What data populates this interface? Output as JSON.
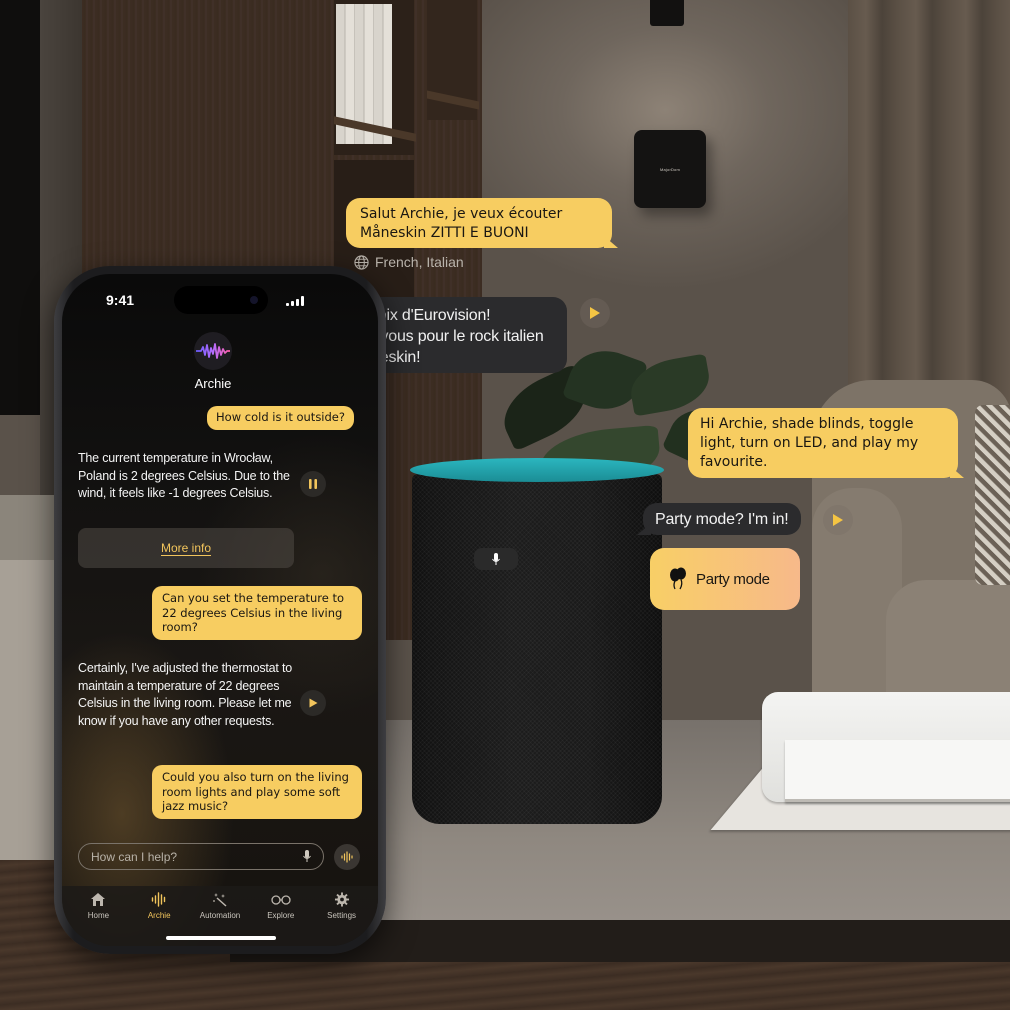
{
  "scene": {
    "hub_brand": "MajorDom",
    "accent_teal": "#22a5ae"
  },
  "floating": {
    "user_french": "Salut Archie, je veux écouter Måneskin ZITTI E BUONI",
    "languages_icon": "globe-icon",
    "languages": "French, Italian",
    "bot_french": "Ah, un choix d'Eurovision! Préparez-vous pour le rock italien avec Måneskin!",
    "user_english": "Hi Archie, shade blinds, toggle light, turn on LED, and play my favourite.",
    "bot_english": "Party mode? I'm in!",
    "party_card_label": "Party mode",
    "party_card_icon": "balloons-icon"
  },
  "phone": {
    "status": {
      "time": "9:41"
    },
    "assistant": {
      "name": "Archie",
      "avatar_icon": "waveform-icon"
    },
    "messages": [
      {
        "role": "user",
        "text": "How cold is it outside?"
      },
      {
        "role": "assistant",
        "text": "The current temperature in Wrocław, Poland is 2 degrees Celsius. Due to the wind, it feels like -1 degrees Celsius.",
        "control": "pause"
      },
      {
        "role": "assistant-action",
        "text": "More info"
      },
      {
        "role": "user",
        "text": "Can you set the temperature to 22 degrees Celsius in the living room?"
      },
      {
        "role": "assistant",
        "text": "Certainly, I've adjusted the thermostat to maintain a temperature of 22 degrees Celsius in the living room. Please let me know if you have any other requests.",
        "control": "play"
      },
      {
        "role": "user",
        "text": "Could you also turn on the living room lights and play some soft jazz music?"
      }
    ],
    "composer": {
      "placeholder": "How can I help?",
      "value": ""
    },
    "tabs": [
      {
        "label": "Home",
        "icon": "home-icon",
        "active": false
      },
      {
        "label": "Archie",
        "icon": "waveform-icon",
        "active": true
      },
      {
        "label": "Automation",
        "icon": "magic-wand-icon",
        "active": false
      },
      {
        "label": "Explore",
        "icon": "glasses-icon",
        "active": false
      },
      {
        "label": "Settings",
        "icon": "gear-icon",
        "active": false
      }
    ],
    "colors": {
      "accent": "#f2c55c",
      "user_bubble": "#f7cd61",
      "assistant_bubble": "#2b2b2d"
    }
  }
}
